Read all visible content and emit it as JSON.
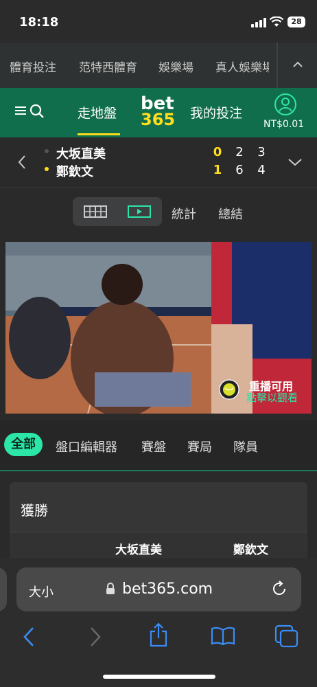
{
  "status_bar": {
    "time": "18:18",
    "battery": "28"
  },
  "top_nav": {
    "items": [
      "體育投注",
      "范特西體育",
      "娛樂場",
      "真人娛樂場"
    ]
  },
  "header": {
    "tab_inplay": "走地盤",
    "logo_bet": "bet",
    "logo_365": "365",
    "tab_mybets": "我的投注",
    "balance": "NT$0.01"
  },
  "match": {
    "player1": {
      "name": "大坂直美",
      "scores": [
        "0",
        "2",
        "3"
      ],
      "serving": false
    },
    "player2": {
      "name": "鄭欽文",
      "scores": [
        "1",
        "6",
        "4"
      ],
      "serving": true
    }
  },
  "controls": {
    "stats": "統計",
    "summary": "總結"
  },
  "video": {
    "replay_title": "重播可用",
    "replay_subtitle": "點擊以觀看"
  },
  "filters": {
    "items": [
      "全部",
      "盤口編輯器",
      "賽盤",
      "賽局",
      "隊員"
    ],
    "active": "全部"
  },
  "market": {
    "title": "獲勝",
    "col1": "大坂直美",
    "col2": "鄭欽文"
  },
  "browser": {
    "text_size": "大小",
    "url": "bet365.com"
  },
  "colors": {
    "brand_green": "#116e4d",
    "accent_yellow": "#ffdf1b",
    "pill_green": "#2ce6a8"
  }
}
